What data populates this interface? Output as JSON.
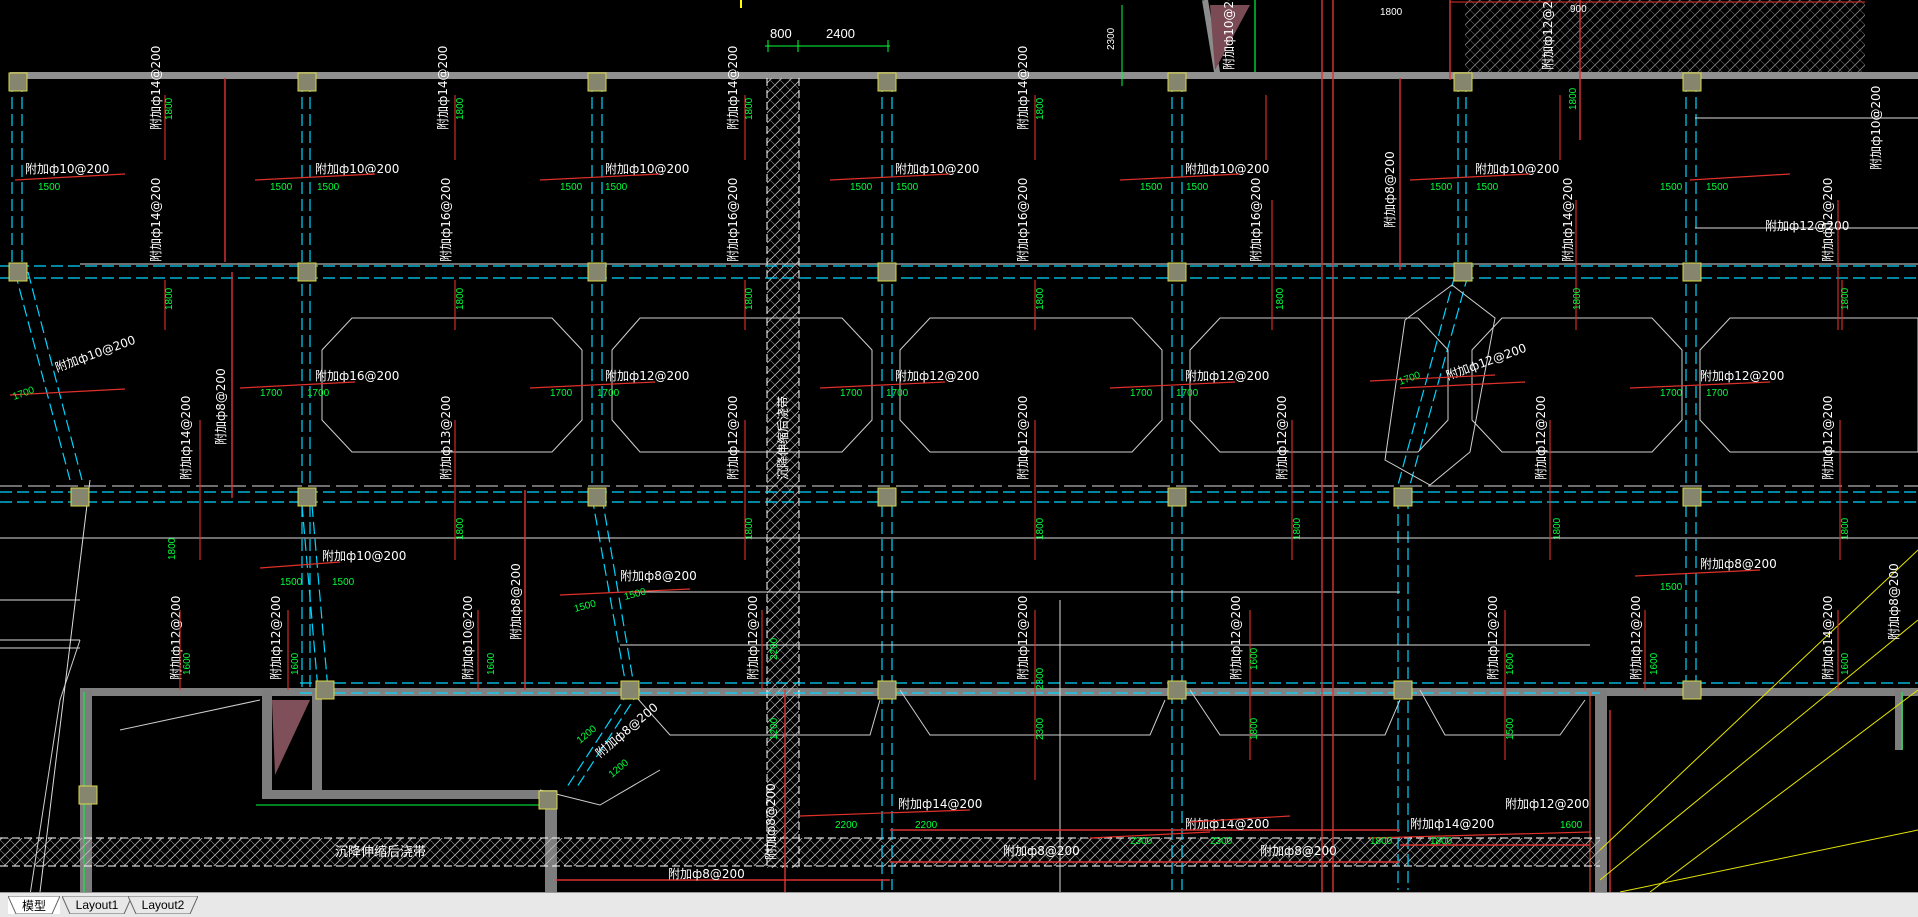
{
  "tabs": [
    {
      "label": "模型",
      "active": true
    },
    {
      "label": "Layout1",
      "active": false
    },
    {
      "label": "Layout2",
      "active": false
    }
  ],
  "colors": {
    "background": "#000000",
    "beam": "#9a9a9a",
    "column": "#8a8a7a",
    "axis_cyan": "#00d5ff",
    "rebar_red": "#e0302a",
    "text_white": "#ffffff",
    "dim_green": "#00ff3c",
    "hatch": "#bcbcbc",
    "yellow": "#ffff00"
  },
  "top_dims": {
    "a": "800",
    "b": "2400",
    "c": "2300",
    "d": "1800",
    "e": "900"
  },
  "rebar_labels": [
    "附加ф14@200",
    "附加ф14@200",
    "附加ф14@200",
    "附加ф14@200",
    "附加ф10@200",
    "附加ф12@200",
    "附加ф10@200",
    "附加ф10@200",
    "附加ф10@200",
    "附加ф10@200",
    "附加ф10@200",
    "附加ф10@200",
    "附加ф8@200",
    "附加ф14@200",
    "附加ф16@200",
    "附加ф16@200",
    "附加ф16@200",
    "附加ф16@200",
    "附加ф14@200",
    "附加ф12@200",
    "附加ф10@200",
    "附加ф16@200",
    "附加ф12@200",
    "附加ф12@200",
    "附加ф12@200",
    "附加ф12@200",
    "附加ф12@200",
    "附加ф14@200",
    "附加ф8@200",
    "附加ф13@200",
    "附加ф12@200",
    "附加ф12@200",
    "附加ф12@200",
    "附加ф12@200",
    "附加ф12@200",
    "附加ф10@200",
    "附加ф8@200",
    "附加ф8@200",
    "附加ф8@200",
    "附加ф12@200",
    "附加ф12@200",
    "附加ф10@200",
    "附加ф12@200",
    "附加ф12@200",
    "附加ф12@200",
    "附加ф12@200",
    "附加ф12@200",
    "附加ф14@200",
    "附加ф8@200",
    "附加ф8@200",
    "附加ф14@200",
    "附加ф14@200",
    "附加ф14@200",
    "附加ф12@200",
    "附加ф8@200",
    "附加ф8@200",
    "附加ф8@200",
    "附加ф10@200",
    "附加ф8@200",
    "附加ф12@200"
  ],
  "hatch_labels": {
    "vertical": "沉降伸缩后浇带",
    "horizontal": "沉降伸缩后浇带"
  },
  "dim_values": [
    "1500",
    "1700",
    "1800",
    "1600",
    "2200",
    "2300",
    "1200",
    "1000",
    "800",
    "1100"
  ]
}
